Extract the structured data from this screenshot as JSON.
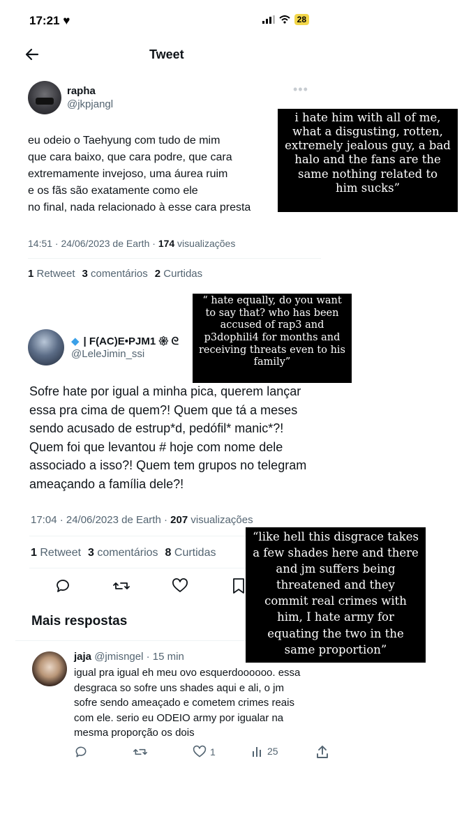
{
  "status_bar": {
    "time": "17:21",
    "battery": "28"
  },
  "header": {
    "title": "Tweet"
  },
  "tweet1": {
    "name": "rapha",
    "handle": "@jkpjangl",
    "lines": [
      "eu odeio o Taehyung com tudo de mim",
      "que cara baixo, que cara podre, que cara",
      "extremamente invejoso, uma áurea ruim",
      "e os fãs são exatamente como ele",
      "no final, nada relacionado à esse cara presta"
    ],
    "meta_prefix": "14:51 · 24/06/2023 de Earth · ",
    "views": "174",
    "views_label": " visualizações",
    "stats": [
      {
        "num": "1",
        "label": " Retweet"
      },
      {
        "num": "3",
        "label": " comentários"
      },
      {
        "num": "2",
        "label": " Curtidas"
      }
    ]
  },
  "tweet2": {
    "name": "| F(AC)E•PJM1 𑁍 ᘓ",
    "handle": "@LeleJimin_ssi",
    "lines": [
      "Sofre hate por igual a minha pica, querem lançar",
      "essa pra cima de quem?! Quem que tá a meses",
      "sendo acusado de estrup*d, pedófil* manic*?!",
      "Quem foi que levantou # hoje com nome dele",
      "associado a isso?! Quem tem grupos no telegram",
      "ameaçando a família dele?!"
    ],
    "meta_prefix": "17:04 · 24/06/2023 de Earth · ",
    "views": "207",
    "views_label": " visualizações",
    "stats": [
      {
        "num": "1",
        "label": " Retweet"
      },
      {
        "num": "3",
        "label": " comentários"
      },
      {
        "num": "8",
        "label": " Curtidas"
      }
    ]
  },
  "more_replies": {
    "title": "Mais respostas"
  },
  "reply": {
    "name": "jaja",
    "handle": "@jmisngel",
    "time": " · 15 min",
    "lines": [
      "igual pra igual eh meu ovo esquerdoooooo. essa",
      "desgraca so sofre uns shades aqui e ali, o jm",
      "sofre sendo ameaçado e cometem crimes reais",
      "com ele. serio eu ODEIO army por igualar na",
      "mesma proporção os dois"
    ],
    "likes": "1",
    "views": "25"
  },
  "captions": {
    "c1": [
      "i hate him with all of me,",
      "what a disgusting, rotten,",
      "extremely jealous guy, a bad",
      "halo and the fans are the",
      "same nothing related to",
      "him sucks”"
    ],
    "c2": [
      "“ hate equally, do you want",
      "to say that? who has been",
      "accused of rap3 and",
      "p3dophili4 for months and",
      "receiving threats even to his",
      "family”"
    ],
    "c3": [
      "“like hell this disgrace takes",
      "a few shades here and there",
      "and jm suffers being",
      "threatened and they",
      "commit real crimes with",
      "him, I hate army for",
      "equating the two in the",
      "same proportion”"
    ]
  }
}
